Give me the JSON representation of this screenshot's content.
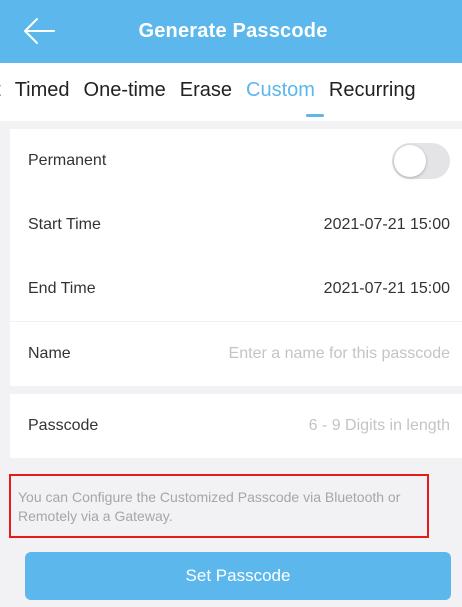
{
  "header": {
    "title": "Generate Passcode",
    "back_icon": "arrow-left-icon"
  },
  "tabs": {
    "items": [
      {
        "label": "nt"
      },
      {
        "label": "Timed"
      },
      {
        "label": "One-time"
      },
      {
        "label": "Erase"
      },
      {
        "label": "Custom"
      },
      {
        "label": "Recurring"
      }
    ],
    "active": "Custom"
  },
  "schedule": {
    "permanent_label": "Permanent",
    "permanent_on": false,
    "start_label": "Start Time",
    "start_value": "2021-07-21 15:00",
    "end_label": "End Time",
    "end_value": "2021-07-21 15:00"
  },
  "name_field": {
    "label": "Name",
    "placeholder": "Enter a name for this passcode"
  },
  "passcode_field": {
    "label": "Passcode",
    "placeholder": "6 - 9 Digits in length"
  },
  "hint": {
    "text": "You can Configure the Customized Passcode via Bluetooth or Remotely via a Gateway."
  },
  "submit": {
    "label": "Set Passcode"
  },
  "colors": {
    "accent": "#5bb7ec",
    "highlight_border": "#e41c1c",
    "background": "#f2f2f4"
  }
}
